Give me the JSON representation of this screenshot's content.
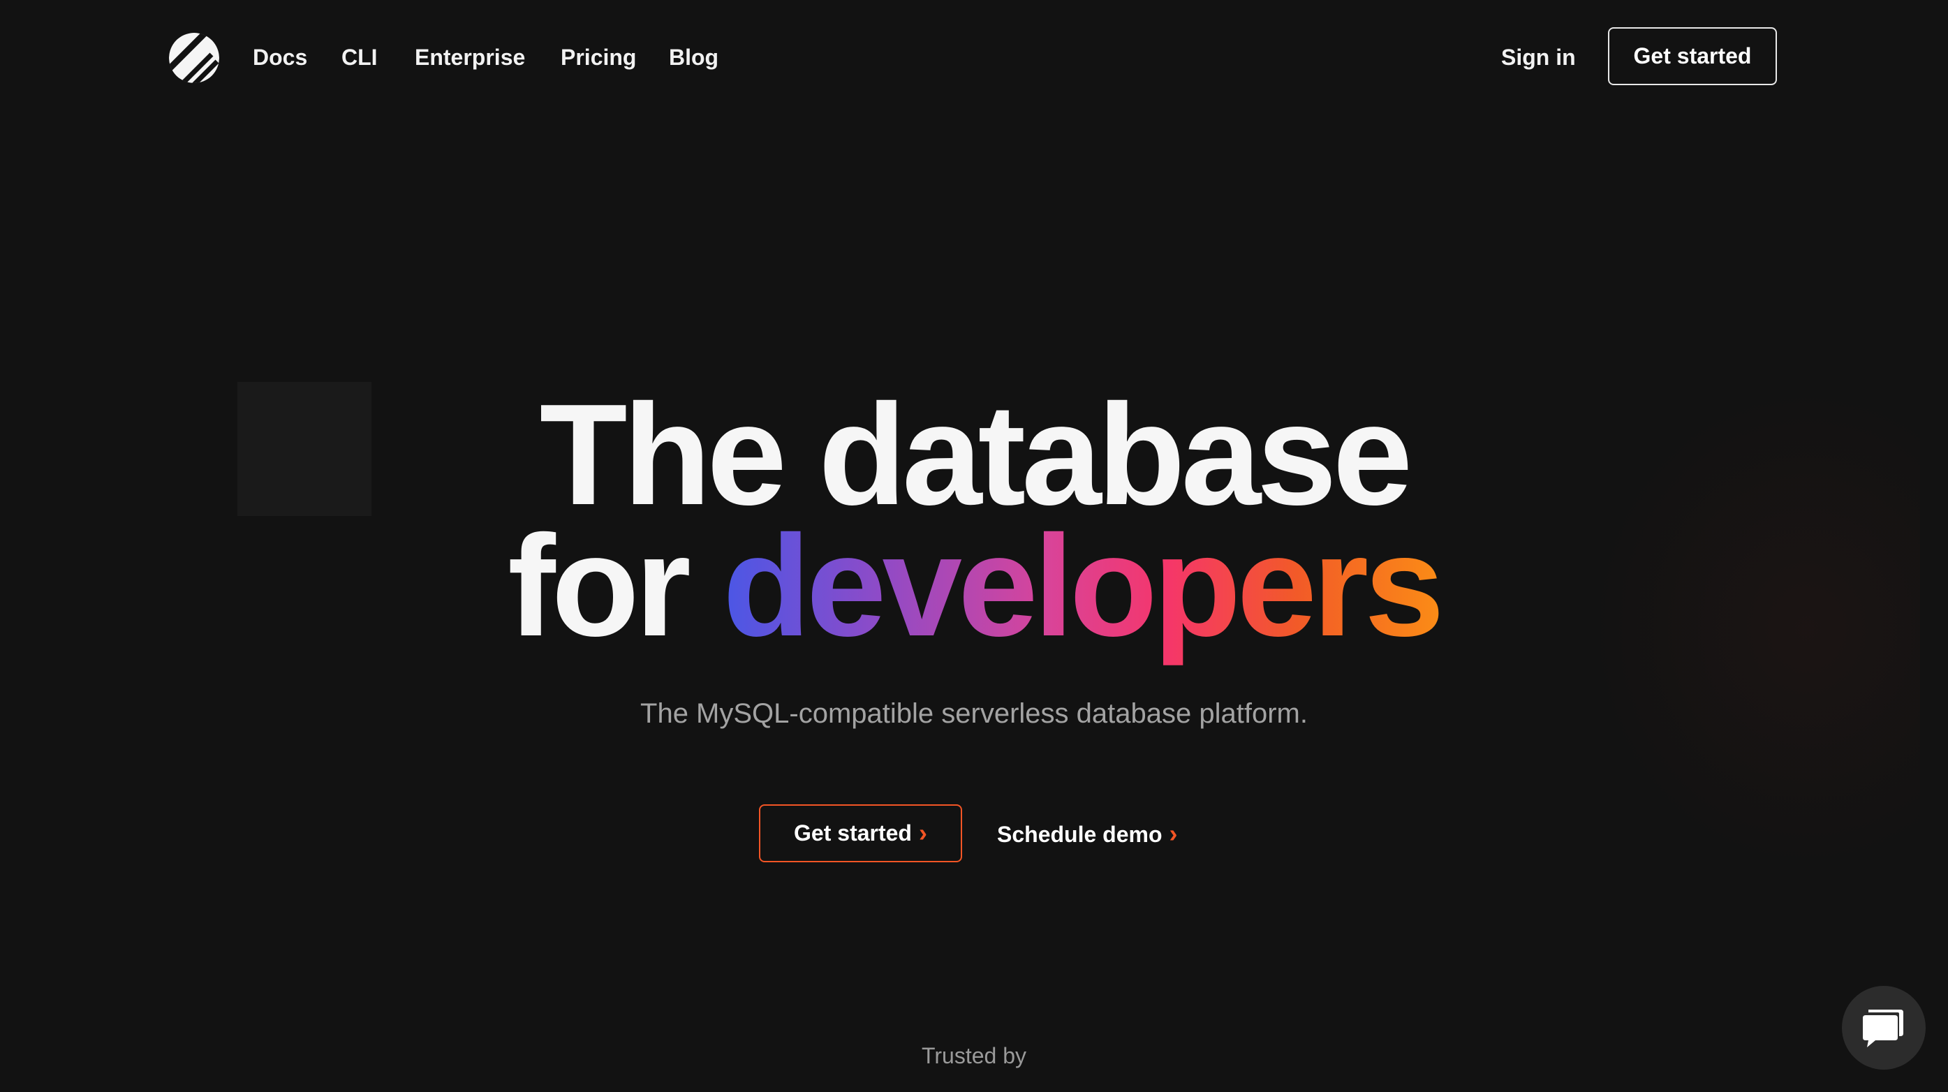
{
  "brand": {
    "logo_icon": "planetscale-logo-icon"
  },
  "nav": {
    "links": [
      {
        "label": "Docs"
      },
      {
        "label": "CLI"
      },
      {
        "label": "Enterprise"
      },
      {
        "label": "Pricing"
      },
      {
        "label": "Blog"
      }
    ],
    "sign_in": "Sign in",
    "cta": "Get started"
  },
  "hero": {
    "headline_line1": "The database",
    "headline_line2_prefix": "for ",
    "headline_line2_highlight": "developers",
    "subtitle": "The MySQL-compatible serverless database platform.",
    "primary_cta": "Get started",
    "secondary_cta": "Schedule demo",
    "chevron_glyph": "›"
  },
  "trusted_by": "Trusted by",
  "chat": {
    "icon": "chat-bubble-icon"
  },
  "colors": {
    "background": "#121212",
    "accent_orange": "#f35525",
    "gradient": [
      "#4a57e6",
      "#8f4bc7",
      "#d8449a",
      "#f5366a",
      "#f25a28",
      "#fb8c16"
    ]
  }
}
